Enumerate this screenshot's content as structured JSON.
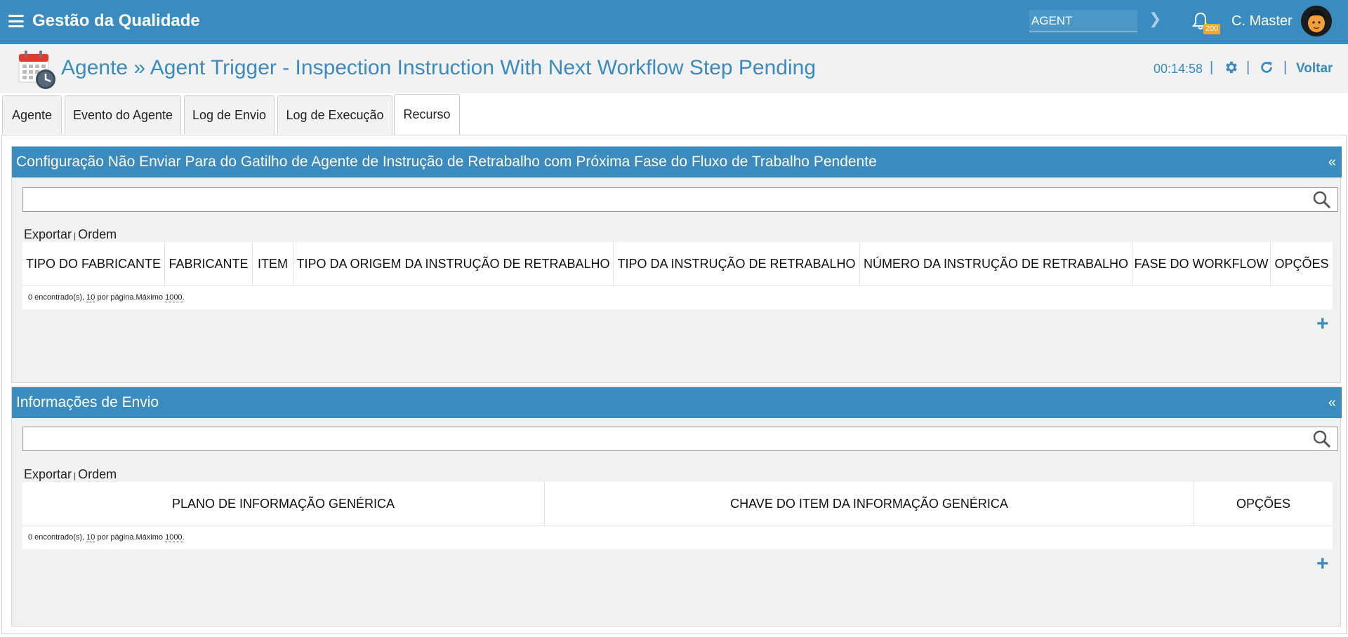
{
  "topbar": {
    "app_title": "Gestão da Qualidade",
    "search_value": "AGENT",
    "notification_count": "200",
    "user_name": "C. Master",
    "bg_color": "#3a8bbf"
  },
  "header": {
    "title": "Agente » Agent Trigger - Inspection Instruction With Next Workflow Step Pending",
    "timer": "00:14:58",
    "back_label": "Voltar"
  },
  "tabs": [
    {
      "label": "Agente"
    },
    {
      "label": "Evento do Agente"
    },
    {
      "label": "Log de Envio"
    },
    {
      "label": "Log de Execução"
    },
    {
      "label": "Recurso",
      "active": true
    }
  ],
  "panel1": {
    "title": "Configuração Não Enviar Para do Gatilho de Agente de Instrução de Retrabalho com Próxima Fase do Fluxo de Trabalho Pendente",
    "collapse": "«",
    "export": "Exportar",
    "separator": "|",
    "order": "Ordem",
    "columns": [
      "TIPO DO FABRICANTE",
      "FABRICANTE",
      "ITEM",
      "TIPO DA ORIGEM DA INSTRUÇÃO DE RETRABALHO",
      "TIPO DA INSTRUÇÃO DE RETRABALHO",
      "NÚMERO DA INSTRUÇÃO DE RETRABALHO",
      "FASE DO WORKFLOW",
      "OPÇÕES"
    ],
    "footer": {
      "found": "0 encontrado(s), ",
      "per_page_value": "10",
      "per_page_text": " por página.Máximo ",
      "max_value": "1000",
      "end": "."
    },
    "add": "+"
  },
  "panel2": {
    "title": "Informações de Envio",
    "collapse": "«",
    "export": "Exportar",
    "separator": "|",
    "order": "Ordem",
    "columns": [
      "PLANO DE INFORMAÇÃO GENÉRICA",
      "CHAVE DO ITEM DA INFORMAÇÃO GENÉRICA",
      "OPÇÕES"
    ],
    "footer": {
      "found": "0 encontrado(s), ",
      "per_page_value": "10",
      "per_page_text": " por página.Máximo ",
      "max_value": "1000",
      "end": "."
    },
    "add": "+"
  }
}
